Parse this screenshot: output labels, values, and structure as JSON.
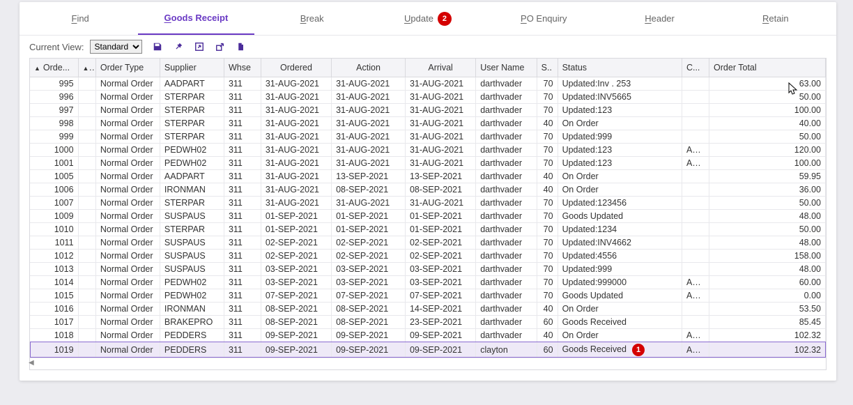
{
  "tabs": {
    "find": {
      "letter": "F",
      "rest": "ind"
    },
    "goods": {
      "letter": "G",
      "rest": "oods Receipt"
    },
    "break": {
      "letter": "B",
      "rest": "reak"
    },
    "update": {
      "letter": "U",
      "rest": "pdate",
      "badge": "2"
    },
    "po": {
      "letter": "P",
      "rest": "O Enquiry"
    },
    "header": {
      "letter": "H",
      "rest": "eader"
    },
    "retain": {
      "letter": "R",
      "rest": "etain"
    }
  },
  "toolbar": {
    "label": "Current View:",
    "view_value": "Standard"
  },
  "columns": {
    "order": "Orde...",
    "type": "Order Type",
    "supplier": "Supplier",
    "whse": "Whse",
    "ordered": "Ordered",
    "action": "Action",
    "arrival": "Arrival",
    "user": "User Name",
    "s": "S..",
    "status": "Status",
    "curr": "C...",
    "total": "Order Total"
  },
  "rows": [
    {
      "order": "995",
      "type": "Normal Order",
      "supp": "AADPART",
      "whse": "311",
      "ordered": "31-AUG-2021",
      "action": "31-AUG-2021",
      "arrival": "31-AUG-2021",
      "user": "darthvader",
      "s": "70",
      "status": "Updated:Inv . 253",
      "curr": "",
      "total": "63.00"
    },
    {
      "order": "996",
      "type": "Normal Order",
      "supp": "STERPAR",
      "whse": "311",
      "ordered": "31-AUG-2021",
      "action": "31-AUG-2021",
      "arrival": "31-AUG-2021",
      "user": "darthvader",
      "s": "70",
      "status": "Updated:INV5665",
      "curr": "",
      "total": "50.00"
    },
    {
      "order": "997",
      "type": "Normal Order",
      "supp": "STERPAR",
      "whse": "311",
      "ordered": "31-AUG-2021",
      "action": "31-AUG-2021",
      "arrival": "31-AUG-2021",
      "user": "darthvader",
      "s": "70",
      "status": "Updated:123",
      "curr": "",
      "total": "100.00"
    },
    {
      "order": "998",
      "type": "Normal Order",
      "supp": "STERPAR",
      "whse": "311",
      "ordered": "31-AUG-2021",
      "action": "31-AUG-2021",
      "arrival": "31-AUG-2021",
      "user": "darthvader",
      "s": "40",
      "status": "On Order",
      "curr": "",
      "total": "40.00"
    },
    {
      "order": "999",
      "type": "Normal Order",
      "supp": "STERPAR",
      "whse": "311",
      "ordered": "31-AUG-2021",
      "action": "31-AUG-2021",
      "arrival": "31-AUG-2021",
      "user": "darthvader",
      "s": "70",
      "status": "Updated:999",
      "curr": "",
      "total": "50.00"
    },
    {
      "order": "1000",
      "type": "Normal Order",
      "supp": "PEDWH02",
      "whse": "311",
      "ordered": "31-AUG-2021",
      "action": "31-AUG-2021",
      "arrival": "31-AUG-2021",
      "user": "darthvader",
      "s": "70",
      "status": "Updated:123",
      "curr": "AUD",
      "total": "120.00"
    },
    {
      "order": "1001",
      "type": "Normal Order",
      "supp": "PEDWH02",
      "whse": "311",
      "ordered": "31-AUG-2021",
      "action": "31-AUG-2021",
      "arrival": "31-AUG-2021",
      "user": "darthvader",
      "s": "70",
      "status": "Updated:123",
      "curr": "AUD",
      "total": "100.00"
    },
    {
      "order": "1005",
      "type": "Normal Order",
      "supp": "AADPART",
      "whse": "311",
      "ordered": "31-AUG-2021",
      "action": "13-SEP-2021",
      "arrival": "13-SEP-2021",
      "user": "darthvader",
      "s": "40",
      "status": "On Order",
      "curr": "",
      "total": "59.95"
    },
    {
      "order": "1006",
      "type": "Normal Order",
      "supp": "IRONMAN",
      "whse": "311",
      "ordered": "31-AUG-2021",
      "action": "08-SEP-2021",
      "arrival": "08-SEP-2021",
      "user": "darthvader",
      "s": "40",
      "status": "On Order",
      "curr": "",
      "total": "36.00"
    },
    {
      "order": "1007",
      "type": "Normal Order",
      "supp": "STERPAR",
      "whse": "311",
      "ordered": "31-AUG-2021",
      "action": "31-AUG-2021",
      "arrival": "31-AUG-2021",
      "user": "darthvader",
      "s": "70",
      "status": "Updated:123456",
      "curr": "",
      "total": "50.00"
    },
    {
      "order": "1009",
      "type": "Normal Order",
      "supp": "SUSPAUS",
      "whse": "311",
      "ordered": "01-SEP-2021",
      "action": "01-SEP-2021",
      "arrival": "01-SEP-2021",
      "user": "darthvader",
      "s": "70",
      "status": "Goods Updated",
      "curr": "",
      "total": "48.00"
    },
    {
      "order": "1010",
      "type": "Normal Order",
      "supp": "STERPAR",
      "whse": "311",
      "ordered": "01-SEP-2021",
      "action": "01-SEP-2021",
      "arrival": "01-SEP-2021",
      "user": "darthvader",
      "s": "70",
      "status": "Updated:1234",
      "curr": "",
      "total": "50.00"
    },
    {
      "order": "1011",
      "type": "Normal Order",
      "supp": "SUSPAUS",
      "whse": "311",
      "ordered": "02-SEP-2021",
      "action": "02-SEP-2021",
      "arrival": "02-SEP-2021",
      "user": "darthvader",
      "s": "70",
      "status": "Updated:INV4662",
      "curr": "",
      "total": "48.00"
    },
    {
      "order": "1012",
      "type": "Normal Order",
      "supp": "SUSPAUS",
      "whse": "311",
      "ordered": "02-SEP-2021",
      "action": "02-SEP-2021",
      "arrival": "02-SEP-2021",
      "user": "darthvader",
      "s": "70",
      "status": "Updated:4556",
      "curr": "",
      "total": "158.00"
    },
    {
      "order": "1013",
      "type": "Normal Order",
      "supp": "SUSPAUS",
      "whse": "311",
      "ordered": "03-SEP-2021",
      "action": "03-SEP-2021",
      "arrival": "03-SEP-2021",
      "user": "darthvader",
      "s": "70",
      "status": "Updated:999",
      "curr": "",
      "total": "48.00"
    },
    {
      "order": "1014",
      "type": "Normal Order",
      "supp": "PEDWH02",
      "whse": "311",
      "ordered": "03-SEP-2021",
      "action": "03-SEP-2021",
      "arrival": "03-SEP-2021",
      "user": "darthvader",
      "s": "70",
      "status": "Updated:999000",
      "curr": "AUD",
      "total": "60.00"
    },
    {
      "order": "1015",
      "type": "Normal Order",
      "supp": "PEDWH02",
      "whse": "311",
      "ordered": "07-SEP-2021",
      "action": "07-SEP-2021",
      "arrival": "07-SEP-2021",
      "user": "darthvader",
      "s": "70",
      "status": "Goods Updated",
      "curr": "AUD",
      "total": "0.00"
    },
    {
      "order": "1016",
      "type": "Normal Order",
      "supp": "IRONMAN",
      "whse": "311",
      "ordered": "08-SEP-2021",
      "action": "08-SEP-2021",
      "arrival": "14-SEP-2021",
      "user": "darthvader",
      "s": "40",
      "status": "On Order",
      "curr": "",
      "total": "53.50"
    },
    {
      "order": "1017",
      "type": "Normal Order",
      "supp": "BRAKEPRO",
      "whse": "311",
      "ordered": "08-SEP-2021",
      "action": "08-SEP-2021",
      "arrival": "23-SEP-2021",
      "user": "darthvader",
      "s": "60",
      "status": "Goods Received",
      "curr": "",
      "total": "85.45"
    },
    {
      "order": "1018",
      "type": "Normal Order",
      "supp": "PEDDERS",
      "whse": "311",
      "ordered": "09-SEP-2021",
      "action": "09-SEP-2021",
      "arrival": "09-SEP-2021",
      "user": "darthvader",
      "s": "40",
      "status": "On Order",
      "curr": "AUD",
      "total": "102.32"
    },
    {
      "order": "1019",
      "type": "Normal Order",
      "supp": "PEDDERS",
      "whse": "311",
      "ordered": "09-SEP-2021",
      "action": "09-SEP-2021",
      "arrival": "09-SEP-2021",
      "user": "clayton",
      "s": "60",
      "status": "Goods Received",
      "curr": "AUD",
      "total": "102.32",
      "badge": "1",
      "selected": true
    }
  ]
}
